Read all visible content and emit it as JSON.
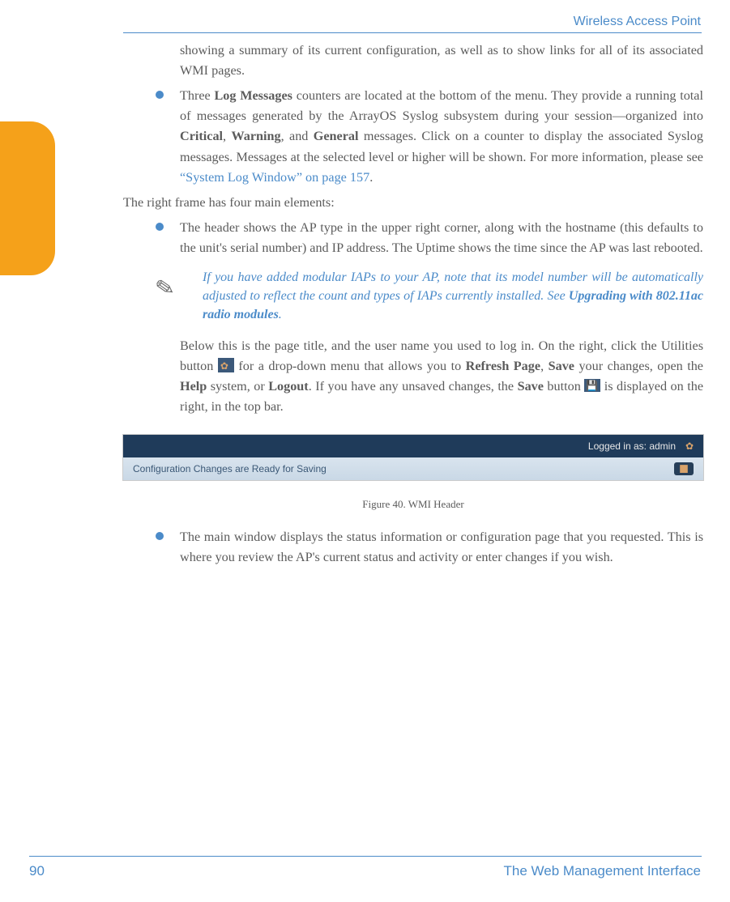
{
  "header": {
    "running_title": "Wireless Access Point"
  },
  "footer": {
    "page_number": "90",
    "section_title": "The Web Management Interface"
  },
  "body": {
    "p0a": "showing a summary of its current configuration, as well as to show links for all of its associated WMI pages.",
    "p1_pre": "Three ",
    "p1_bold1": "Log Messages",
    "p1_mid1": " counters are located at the bottom of the menu. They provide a running total of messages generated by the ArrayOS Syslog subsystem during your session—organized into ",
    "p1_bold2": "Critical",
    "p1_mid2": ", ",
    "p1_bold3": "Warning",
    "p1_mid3": ", and ",
    "p1_bold4": "General",
    "p1_mid4": " messages. Click on a counter to display the associated Syslog messages. Messages at the selected level or higher will be shown. For more information, please see ",
    "p1_link": "“System Log Window” on page 157",
    "p1_end": ".",
    "p2": "The right frame has four main elements:",
    "p3": "The header shows the AP type in the upper right corner, along with the hostname (this defaults to the unit's serial number) and IP address. The Uptime shows the time since the AP was last rebooted.",
    "note_pre": "If you have added modular IAPs to your AP, note that its model number will be automatically adjusted to reflect the count and types of IAPs currently installed. See ",
    "note_bold": "Upgrading with 802.11ac radio modules",
    "note_end": ".",
    "p4_pre": "Below this is the page title, and the user name you used to log in. On the right, click the Utilities button ",
    "p4_mid1": " for a drop-down menu that allows you to ",
    "p4_b1": "Refresh Page",
    "p4_m1": ", ",
    "p4_b2": "Save",
    "p4_m2": " your changes, open the ",
    "p4_b3": "Help",
    "p4_m3": " system, or ",
    "p4_b4": "Logout",
    "p4_m4": ". If you have any unsaved changes, the ",
    "p4_b5": "Save",
    "p4_m5": " button ",
    "p4_end": " is displayed on the right, in the top bar.",
    "p5": "The main window displays the status information or configuration page that you requested. This is where you review the AP's current status and activity or enter changes if you wish."
  },
  "figure": {
    "logged_in_text": "Logged in as: admin",
    "status_text": "Configuration Changes are Ready for Saving",
    "caption": "Figure 40. WMI Header"
  }
}
